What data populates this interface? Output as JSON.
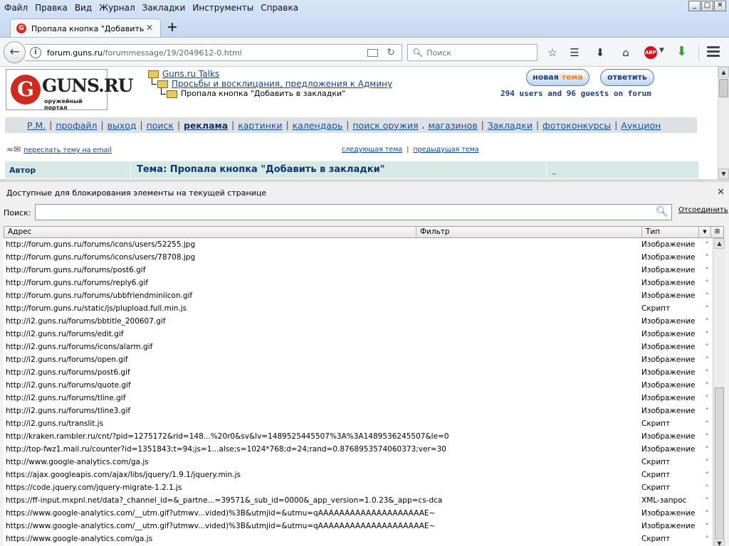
{
  "menu": [
    "Файл",
    "Правка",
    "Вид",
    "Журнал",
    "Закладки",
    "Инструменты",
    "Справка"
  ],
  "window_controls": {
    "minimize": "_",
    "maximize": "□",
    "close": "✕"
  },
  "tab": {
    "title": "Пропала кнопка \"Добавить ...",
    "close": "✕",
    "new_tab": "+"
  },
  "navbar": {
    "url_domain": "forum.guns.ru",
    "url_path": "/forummessage/19/2049612-0.html",
    "search_placeholder": "Поиск",
    "abp_label": "ABP",
    "icons": [
      "back-icon",
      "info-icon",
      "reader-icon",
      "reload-icon",
      "search-icon",
      "bookmark-star-icon",
      "bookmarks-list-icon",
      "downloads-icon",
      "home-icon",
      "adblock-icon",
      "download-green-icon",
      "menu-icon"
    ]
  },
  "page": {
    "logo": {
      "letter": "G",
      "name": "GUNS.RU",
      "subtitle": "оружейный портал"
    },
    "breadcrumb": [
      "Guns.ru Talks",
      "Просьбы и восклицания, предложения к Админу",
      "Пропала кнопка \"Добавить в закладки\""
    ],
    "buttons": {
      "new_topic_a": "новая ",
      "new_topic_b": "тема",
      "reply": "ответить"
    },
    "online": "294 users and 96 guests on forum",
    "nav": [
      "Р.М.",
      "профайл",
      "выход",
      "поиск",
      "реклама",
      "картинки",
      "календарь",
      "поиск оружия",
      "магазинов",
      "Закладки",
      "фотоконкурсы",
      "Аукцион"
    ],
    "forward_link": "переслать тему на email",
    "next_topic": "следующая тема",
    "prev_topic": "предыдущая тема",
    "thead": {
      "author": "Автор",
      "topic": "Тема:  Пропала кнопка \"Добавить в закладки\"",
      "extra": "_"
    }
  },
  "panel": {
    "title": "Доступные для блокирования элементы на текущей странице",
    "close": "✕",
    "search_label": "Поиск:",
    "search_value": "",
    "reset_link": "Отсоединить",
    "columns": {
      "address": "Адрес",
      "filter": "Фильтр",
      "type": "Тип",
      "sort": "▼",
      "picker": "⊞"
    },
    "rows": [
      {
        "address": "http://forum.guns.ru/forums/icons/users/52255.jpg",
        "type": "Изображение"
      },
      {
        "address": "http://forum.guns.ru/forums/icons/users/78708.jpg",
        "type": "Изображение"
      },
      {
        "address": "http://forum.guns.ru/forums/post6.gif",
        "type": "Изображение"
      },
      {
        "address": "http://forum.guns.ru/forums/reply6.gif",
        "type": "Изображение"
      },
      {
        "address": "http://forum.guns.ru/forums/ubbfriendminiicon.gif",
        "type": "Изображение"
      },
      {
        "address": "http://forum.guns.ru/static/js/plupload.full.min.js",
        "type": "Скрипт"
      },
      {
        "address": "http://i2.guns.ru/forums/bbtitle_200607.gif",
        "type": "Изображение"
      },
      {
        "address": "http://i2.guns.ru/forums/edit.gif",
        "type": "Изображение"
      },
      {
        "address": "http://i2.guns.ru/forums/icons/alarm.gif",
        "type": "Изображение"
      },
      {
        "address": "http://i2.guns.ru/forums/open.gif",
        "type": "Изображение"
      },
      {
        "address": "http://i2.guns.ru/forums/post6.gif",
        "type": "Изображение"
      },
      {
        "address": "http://i2.guns.ru/forums/quote.gif",
        "type": "Изображение"
      },
      {
        "address": "http://i2.guns.ru/forums/tline.gif",
        "type": "Изображение"
      },
      {
        "address": "http://i2.guns.ru/forums/tline3.gif",
        "type": "Изображение"
      },
      {
        "address": "http://i2.guns.ru/translit.js",
        "type": "Скрипт"
      },
      {
        "address": "http://kraken.rambler.ru/cnt/?pid=1275172&rid=148...%20r0&sv&lv=1489525445507%3A%3A1489536245507&le=0",
        "type": "Изображение"
      },
      {
        "address": "http://top-fwz1.mail.ru/counter?id=1351843;t=94;js=1...alse;s=1024*768;d=24;rand=0.8768953574060373;ver=30",
        "type": "Изображение"
      },
      {
        "address": "http://www.google-analytics.com/ga.js",
        "type": "Скрипт"
      },
      {
        "address": "https://ajax.googleapis.com/ajax/libs/jquery/1.9.1/jquery.min.js",
        "type": "Скрипт"
      },
      {
        "address": "https://code.jquery.com/jquery-migrate-1.2.1.js",
        "type": "Скрипт"
      },
      {
        "address": "https://ff-input.mxpnl.net/data?_channel_id=&_partne...=39571&_sub_id=0000&_app_version=1.0.23&_app=cs-dca",
        "type": "XML-запрос"
      },
      {
        "address": "https://www.google-analytics.com/__utm.gif?utmwv...vided)%3B&utmjid=&utmu=qAAAAAAAAAAAAAAAAAAAAE~",
        "type": "Изображение"
      },
      {
        "address": "https://www.google-analytics.com/__utm.gif?utmwv...vided)%3B&utmjid=&utmu=qAAAAAAAAAAAAAAAAAAAAE~",
        "type": "Изображение"
      },
      {
        "address": "https://www.google-analytics.com/ga.js",
        "type": "Скрипт"
      }
    ]
  }
}
